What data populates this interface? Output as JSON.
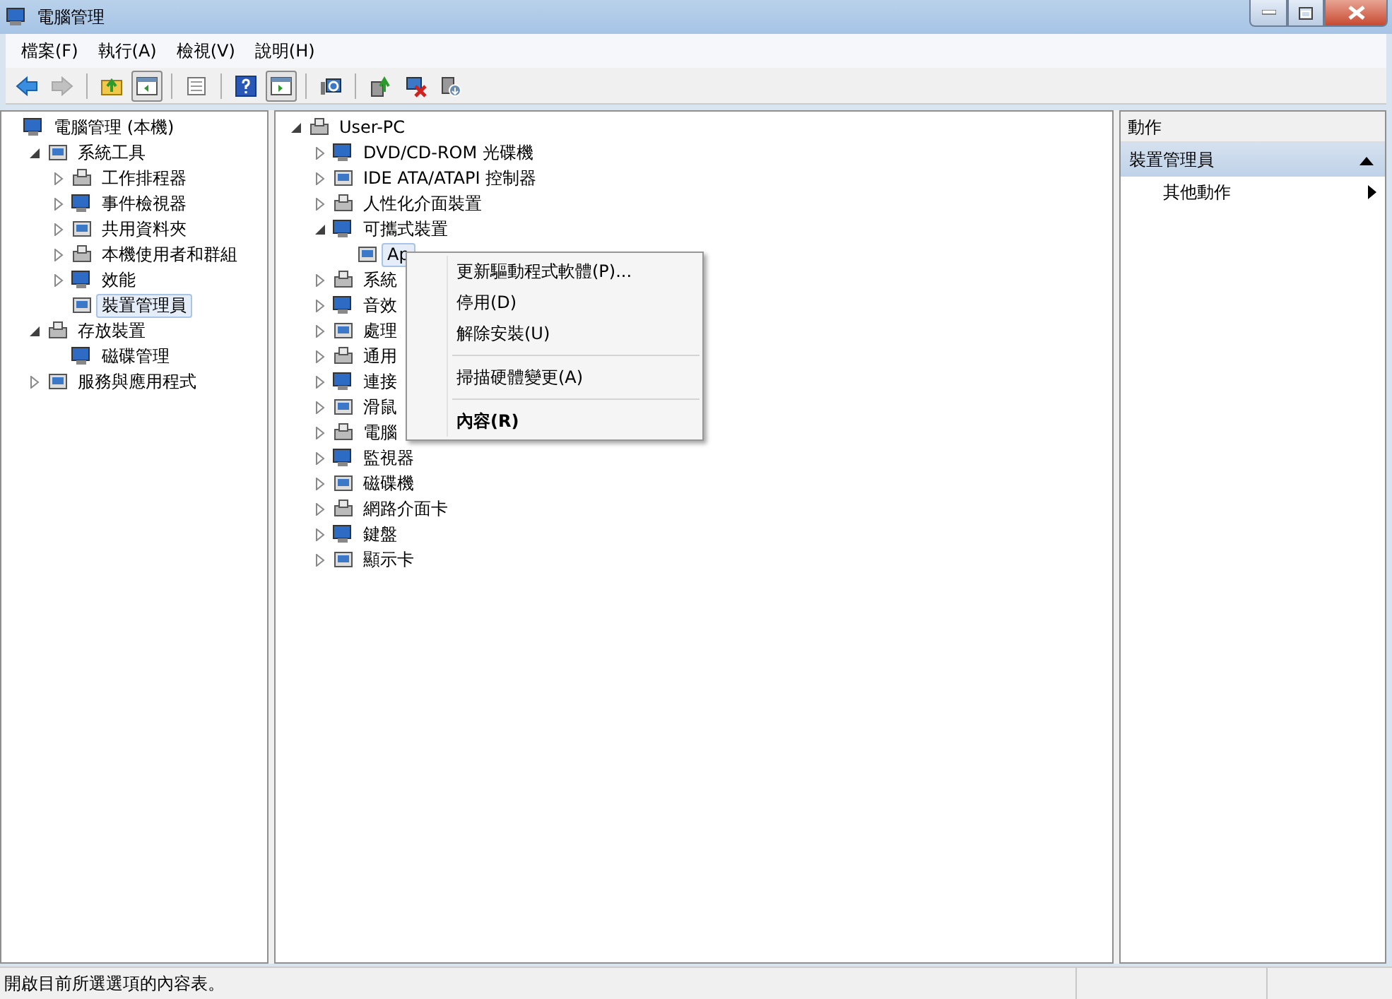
{
  "window": {
    "title": "電腦管理"
  },
  "menu_bar": [
    "檔案(F)",
    "執行(A)",
    "檢視(V)",
    "說明(H)"
  ],
  "toolbar": [
    {
      "pressed": false,
      "disabled": false
    },
    {
      "pressed": false,
      "disabled": true
    },
    {
      "pressed": false,
      "disabled": false
    },
    {
      "pressed": true,
      "disabled": false
    },
    {
      "pressed": false,
      "disabled": false
    },
    {
      "pressed": false,
      "disabled": false
    },
    {
      "pressed": true,
      "disabled": false
    },
    {
      "pressed": false,
      "disabled": false
    },
    {
      "pressed": false,
      "disabled": false
    },
    {
      "pressed": false,
      "disabled": false
    },
    {
      "pressed": false,
      "disabled": false
    }
  ],
  "console_tree": [
    {
      "label": "電腦管理 (本機)",
      "selected": false,
      "children": [
        {
          "label": "系統工具",
          "expanded": true,
          "selected": false,
          "children": [
            {
              "label": "工作排程器",
              "expanded": false,
              "selected": false
            },
            {
              "label": "事件檢視器",
              "expanded": false,
              "selected": false
            },
            {
              "label": "共用資料夾",
              "expanded": false,
              "selected": false
            },
            {
              "label": "本機使用者和群組",
              "expanded": false,
              "selected": false
            },
            {
              "label": "效能",
              "expanded": false,
              "selected": false
            },
            {
              "label": "裝置管理員",
              "selected": true
            }
          ]
        },
        {
          "label": "存放裝置",
          "expanded": true,
          "selected": false,
          "children": [
            {
              "label": "磁碟管理",
              "selected": false
            }
          ]
        },
        {
          "label": "服務與應用程式",
          "expanded": false,
          "selected": false
        }
      ]
    }
  ],
  "device_tree": [
    {
      "label": "User-PC",
      "expanded": true,
      "selected": false,
      "children": [
        {
          "label": "DVD/CD-ROM 光碟機",
          "expanded": false,
          "selected": false
        },
        {
          "label": "IDE ATA/ATAPI 控制器",
          "expanded": false,
          "selected": false
        },
        {
          "label": "人性化介面裝置",
          "expanded": false,
          "selected": false
        },
        {
          "label": "可攜式裝置",
          "expanded": true,
          "selected": false,
          "children": [
            {
              "label": "Ap",
              "selected": true
            }
          ]
        },
        {
          "label": "系統",
          "expanded": false,
          "selected": false
        },
        {
          "label": "音效",
          "expanded": false,
          "selected": false
        },
        {
          "label": "處理",
          "expanded": false,
          "selected": false
        },
        {
          "label": "通用",
          "expanded": false,
          "selected": false
        },
        {
          "label": "連接",
          "expanded": false,
          "selected": false
        },
        {
          "label": "滑鼠",
          "expanded": false,
          "selected": false
        },
        {
          "label": "電腦",
          "expanded": false,
          "selected": false
        },
        {
          "label": "監視器",
          "expanded": false,
          "selected": false
        },
        {
          "label": "磁碟機",
          "expanded": false,
          "selected": false
        },
        {
          "label": "網路介面卡",
          "expanded": false,
          "selected": false
        },
        {
          "label": "鍵盤",
          "expanded": false,
          "selected": false
        },
        {
          "label": "顯示卡",
          "expanded": false,
          "selected": false
        }
      ]
    }
  ],
  "context_menu": [
    {
      "label": "更新驅動程式軟體(P)...",
      "separator_before": false,
      "default": false
    },
    {
      "label": "停用(D)",
      "separator_before": false,
      "default": false
    },
    {
      "label": "解除安裝(U)",
      "separator_before": false,
      "default": false
    },
    {
      "label": "掃描硬體變更(A)",
      "separator_before": true,
      "default": false
    },
    {
      "label": "內容(R)",
      "separator_before": true,
      "default": true
    }
  ],
  "actions_pane": {
    "header": "動作",
    "sections": [
      {
        "title": "裝置管理員",
        "expanded": true,
        "items": [
          {
            "label": "其他動作",
            "submenu": true
          }
        ]
      }
    ]
  },
  "status_bar": {
    "text": "開啟目前所選選項的內容表。"
  }
}
